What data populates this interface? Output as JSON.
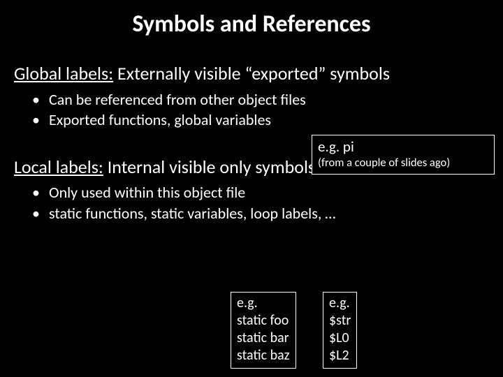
{
  "title": "Symbols and References",
  "section1": {
    "label": "Global labels:",
    "desc": " Externally visible “exported” symbols",
    "bullets": [
      "Can be referenced from other object files",
      "Exported functions, global variables"
    ]
  },
  "box1": {
    "line1": "e.g. pi",
    "line2": "(from a couple of slides ago)"
  },
  "section2": {
    "label": "Local labels:",
    "desc": "  Internal  visible only symbols",
    "bullets": [
      "Only used within this object file",
      "static functions, static variables, loop labels, …"
    ]
  },
  "box2": {
    "l1": "e.g.",
    "l2": "static foo",
    "l3": "static bar",
    "l4": "static baz"
  },
  "box3": {
    "l1": "e.g.",
    "l2": "$str",
    "l3": "$L0",
    "l4": "$L2"
  }
}
